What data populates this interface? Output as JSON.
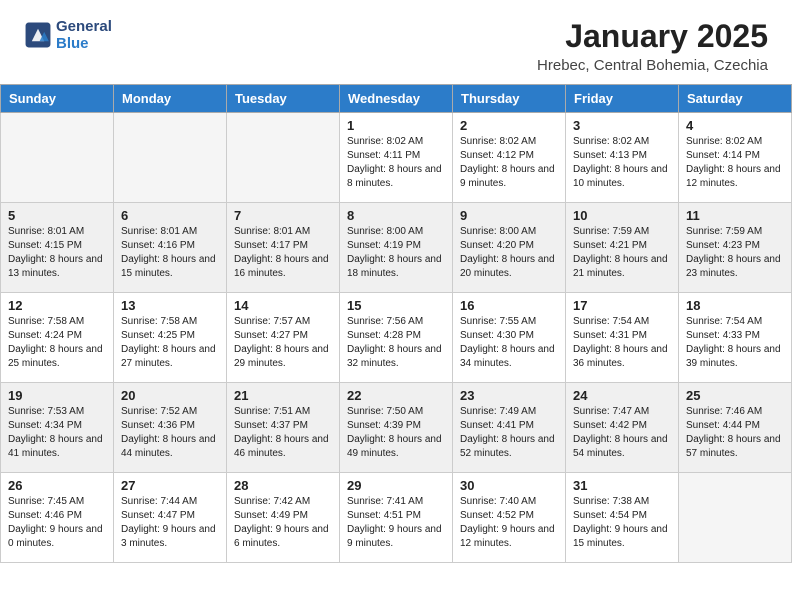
{
  "header": {
    "logo_general": "General",
    "logo_blue": "Blue",
    "month": "January 2025",
    "location": "Hrebec, Central Bohemia, Czechia"
  },
  "days_of_week": [
    "Sunday",
    "Monday",
    "Tuesday",
    "Wednesday",
    "Thursday",
    "Friday",
    "Saturday"
  ],
  "weeks": [
    [
      {
        "day": "",
        "empty": true
      },
      {
        "day": "",
        "empty": true
      },
      {
        "day": "",
        "empty": true
      },
      {
        "day": "1",
        "sunrise": "8:02 AM",
        "sunset": "4:11 PM",
        "daylight": "8 hours and 8 minutes."
      },
      {
        "day": "2",
        "sunrise": "8:02 AM",
        "sunset": "4:12 PM",
        "daylight": "8 hours and 9 minutes."
      },
      {
        "day": "3",
        "sunrise": "8:02 AM",
        "sunset": "4:13 PM",
        "daylight": "8 hours and 10 minutes."
      },
      {
        "day": "4",
        "sunrise": "8:02 AM",
        "sunset": "4:14 PM",
        "daylight": "8 hours and 12 minutes."
      }
    ],
    [
      {
        "day": "5",
        "sunrise": "8:01 AM",
        "sunset": "4:15 PM",
        "daylight": "8 hours and 13 minutes."
      },
      {
        "day": "6",
        "sunrise": "8:01 AM",
        "sunset": "4:16 PM",
        "daylight": "8 hours and 15 minutes."
      },
      {
        "day": "7",
        "sunrise": "8:01 AM",
        "sunset": "4:17 PM",
        "daylight": "8 hours and 16 minutes."
      },
      {
        "day": "8",
        "sunrise": "8:00 AM",
        "sunset": "4:19 PM",
        "daylight": "8 hours and 18 minutes."
      },
      {
        "day": "9",
        "sunrise": "8:00 AM",
        "sunset": "4:20 PM",
        "daylight": "8 hours and 20 minutes."
      },
      {
        "day": "10",
        "sunrise": "7:59 AM",
        "sunset": "4:21 PM",
        "daylight": "8 hours and 21 minutes."
      },
      {
        "day": "11",
        "sunrise": "7:59 AM",
        "sunset": "4:23 PM",
        "daylight": "8 hours and 23 minutes."
      }
    ],
    [
      {
        "day": "12",
        "sunrise": "7:58 AM",
        "sunset": "4:24 PM",
        "daylight": "8 hours and 25 minutes."
      },
      {
        "day": "13",
        "sunrise": "7:58 AM",
        "sunset": "4:25 PM",
        "daylight": "8 hours and 27 minutes."
      },
      {
        "day": "14",
        "sunrise": "7:57 AM",
        "sunset": "4:27 PM",
        "daylight": "8 hours and 29 minutes."
      },
      {
        "day": "15",
        "sunrise": "7:56 AM",
        "sunset": "4:28 PM",
        "daylight": "8 hours and 32 minutes."
      },
      {
        "day": "16",
        "sunrise": "7:55 AM",
        "sunset": "4:30 PM",
        "daylight": "8 hours and 34 minutes."
      },
      {
        "day": "17",
        "sunrise": "7:54 AM",
        "sunset": "4:31 PM",
        "daylight": "8 hours and 36 minutes."
      },
      {
        "day": "18",
        "sunrise": "7:54 AM",
        "sunset": "4:33 PM",
        "daylight": "8 hours and 39 minutes."
      }
    ],
    [
      {
        "day": "19",
        "sunrise": "7:53 AM",
        "sunset": "4:34 PM",
        "daylight": "8 hours and 41 minutes."
      },
      {
        "day": "20",
        "sunrise": "7:52 AM",
        "sunset": "4:36 PM",
        "daylight": "8 hours and 44 minutes."
      },
      {
        "day": "21",
        "sunrise": "7:51 AM",
        "sunset": "4:37 PM",
        "daylight": "8 hours and 46 minutes."
      },
      {
        "day": "22",
        "sunrise": "7:50 AM",
        "sunset": "4:39 PM",
        "daylight": "8 hours and 49 minutes."
      },
      {
        "day": "23",
        "sunrise": "7:49 AM",
        "sunset": "4:41 PM",
        "daylight": "8 hours and 52 minutes."
      },
      {
        "day": "24",
        "sunrise": "7:47 AM",
        "sunset": "4:42 PM",
        "daylight": "8 hours and 54 minutes."
      },
      {
        "day": "25",
        "sunrise": "7:46 AM",
        "sunset": "4:44 PM",
        "daylight": "8 hours and 57 minutes."
      }
    ],
    [
      {
        "day": "26",
        "sunrise": "7:45 AM",
        "sunset": "4:46 PM",
        "daylight": "9 hours and 0 minutes."
      },
      {
        "day": "27",
        "sunrise": "7:44 AM",
        "sunset": "4:47 PM",
        "daylight": "9 hours and 3 minutes."
      },
      {
        "day": "28",
        "sunrise": "7:42 AM",
        "sunset": "4:49 PM",
        "daylight": "9 hours and 6 minutes."
      },
      {
        "day": "29",
        "sunrise": "7:41 AM",
        "sunset": "4:51 PM",
        "daylight": "9 hours and 9 minutes."
      },
      {
        "day": "30",
        "sunrise": "7:40 AM",
        "sunset": "4:52 PM",
        "daylight": "9 hours and 12 minutes."
      },
      {
        "day": "31",
        "sunrise": "7:38 AM",
        "sunset": "4:54 PM",
        "daylight": "9 hours and 15 minutes."
      },
      {
        "day": "",
        "empty": true
      }
    ]
  ],
  "labels": {
    "sunrise": "Sunrise:",
    "sunset": "Sunset:",
    "daylight": "Daylight:"
  },
  "colors": {
    "header_bg": "#2c7cc9",
    "logo_dark": "#2c4a7c"
  }
}
